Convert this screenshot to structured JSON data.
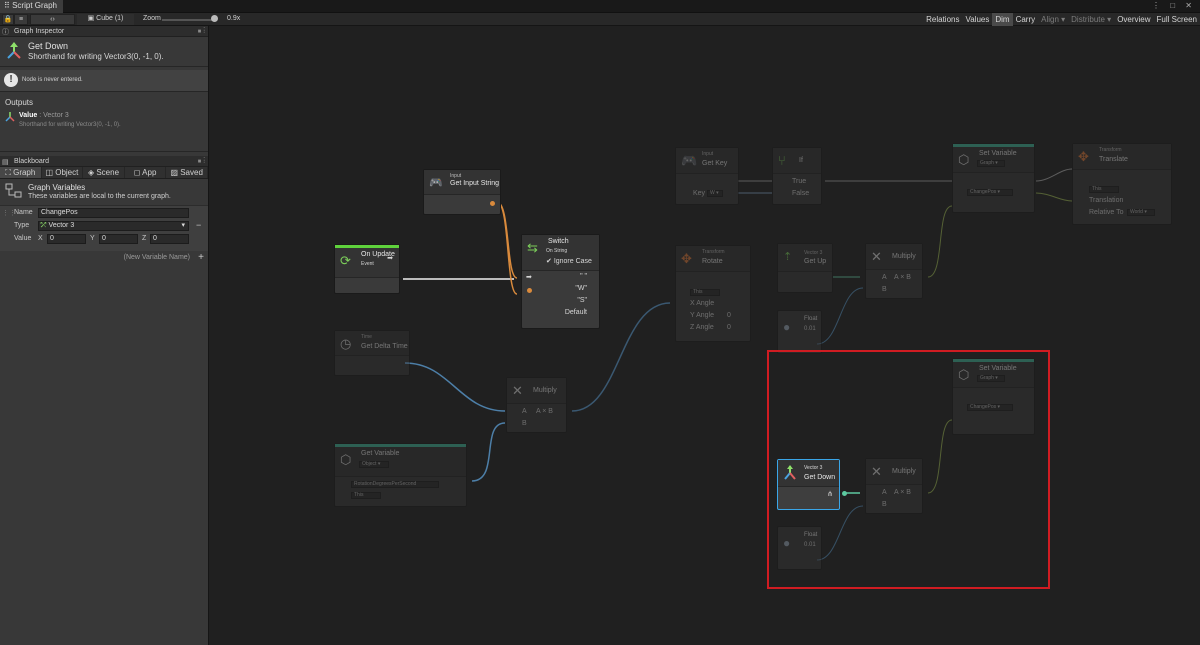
{
  "window": {
    "tab_title": "Script Graph",
    "controls": "⋮ □ ✕"
  },
  "toolbar": {
    "target_name": "Cube (1)",
    "zoom_label": "Zoom",
    "zoom_value": "0.9x",
    "right_items": [
      "Relations",
      "Values",
      "Dim",
      "Carry",
      "Align ▾",
      "Distribute ▾",
      "Overview",
      "Full Screen"
    ]
  },
  "graph_inspector": {
    "header": "Graph Inspector",
    "title": "Get Down",
    "subtitle": "Shorthand for writing Vector3(0, -1, 0).",
    "warning": "Node is never entered.",
    "outputs_header": "Outputs",
    "output_label": "Value",
    "output_type": ": Vector 3",
    "output_desc": "Shorthand for writing Vector3(0, -1, 0)."
  },
  "blackboard": {
    "header": "Blackboard",
    "tabs": [
      "Graph",
      "Object",
      "Scene",
      "App",
      "Saved"
    ],
    "section_title": "Graph Variables",
    "section_desc": "These variables are local to the current graph.",
    "var": {
      "name_label": "Name",
      "name_value": "ChangePos",
      "type_label": "Type",
      "type_value": "Vector 3",
      "value_label": "Value",
      "x_label": "X",
      "x_value": "0",
      "y_label": "Y",
      "y_value": "0",
      "z_label": "Z",
      "z_value": "0"
    },
    "new_variable_placeholder": "(New Variable Name)"
  },
  "nodes": {
    "on_update": {
      "title": "On Update",
      "sub": "Event"
    },
    "input_get_string": {
      "sub": "Input",
      "title": "Get Input String"
    },
    "switch": {
      "title": "Switch",
      "sub": "On String",
      "ignore_case": "Ignore Case",
      "cases": [
        "\" \"",
        "\"W\"",
        "\"S\"",
        "Default"
      ]
    },
    "time": {
      "sub": "Time",
      "title": "Get Delta Time"
    },
    "multiply_1": {
      "title": "Multiply",
      "a": "A",
      "axb": "A × B",
      "b": "B"
    },
    "get_variable": {
      "title": "Get Variable",
      "scope": "Object ▾",
      "name": "RotationDegreesPerSecond",
      "target": "This"
    },
    "input_get_key": {
      "sub": "Input",
      "title": "Get Key",
      "key_label": "Key",
      "key_value": "W ▾"
    },
    "if": {
      "title": "If",
      "true_label": "True",
      "false_label": "False"
    },
    "rotate": {
      "sub": "Transform",
      "title": "Rotate",
      "target": "This",
      "x": "X Angle",
      "y": "Y Angle",
      "y_val": "0",
      "z": "Z Angle",
      "z_val": "0"
    },
    "get_up": {
      "sub": "Vector 3",
      "title": "Get Up"
    },
    "multiply_2": {
      "title": "Multiply",
      "a": "A",
      "axb": "A × B",
      "b": "B"
    },
    "float_1": {
      "title": "Float",
      "value": "0.01"
    },
    "set_variable_1": {
      "title": "Set Variable",
      "scope": "Graph ▾",
      "name": "ChangePos ▾"
    },
    "translate": {
      "sub": "Transform",
      "title": "Translate",
      "target": "This",
      "translation": "Translation",
      "relative": "Relative To",
      "relative_value": "World ▾"
    },
    "set_variable_2": {
      "title": "Set Variable",
      "scope": "Graph ▾",
      "name": "ChangePos ▾"
    },
    "get_down": {
      "sub": "Vector 3",
      "title": "Get Down"
    },
    "multiply_3": {
      "title": "Multiply",
      "a": "A",
      "axb": "A × B",
      "b": "B"
    },
    "float_2": {
      "title": "Float",
      "value": "0.01"
    }
  },
  "colors": {
    "accent_green": "#8ee06a",
    "highlight_red": "#d01c22",
    "selection_blue": "#3aa6e8",
    "orange_wire": "#d98a3c",
    "blue_wire": "#4d7fa8",
    "olive_wire": "#8aa24a"
  }
}
